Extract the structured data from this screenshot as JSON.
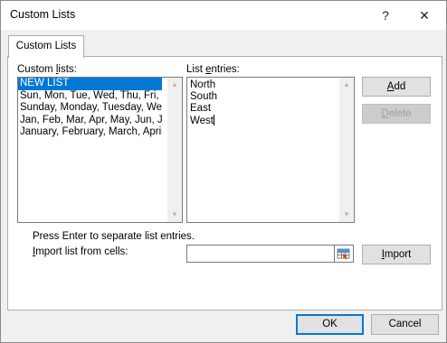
{
  "window": {
    "title": "Custom Lists",
    "help_glyph": "?",
    "close_glyph": "✕"
  },
  "tabs": [
    {
      "label": "Custom Lists"
    }
  ],
  "custom_lists": {
    "label_prefix": "Custom ",
    "label_accel": "l",
    "label_suffix": "ists:",
    "items": [
      "NEW LIST",
      "Sun, Mon, Tue, Wed, Thu, Fri, Sat",
      "Sunday, Monday, Tuesday, Wednesday, Thursday, Friday, Saturday",
      "Jan, Feb, Mar, Apr, May, Jun, Jul, Aug, Sep, Oct, Nov, Dec",
      "January, February, March, April, May, June, July, August, September, October, November, December"
    ],
    "selected_index": 0
  },
  "list_entries": {
    "label_prefix": "List ",
    "label_accel": "e",
    "label_suffix": "ntries:",
    "lines": [
      "North",
      "South",
      "East",
      "West"
    ]
  },
  "buttons": {
    "add": {
      "accel": "A",
      "rest": "dd"
    },
    "delete": {
      "accel": "D",
      "rest": "elete"
    },
    "import": {
      "accel": "I",
      "rest": "mport"
    },
    "ok": "OK",
    "cancel": "Cancel"
  },
  "hint": "Press Enter to separate list entries.",
  "import_cells": {
    "label_prefix": "",
    "label_accel": "I",
    "label_suffix": "mport list from cells:",
    "value": ""
  }
}
